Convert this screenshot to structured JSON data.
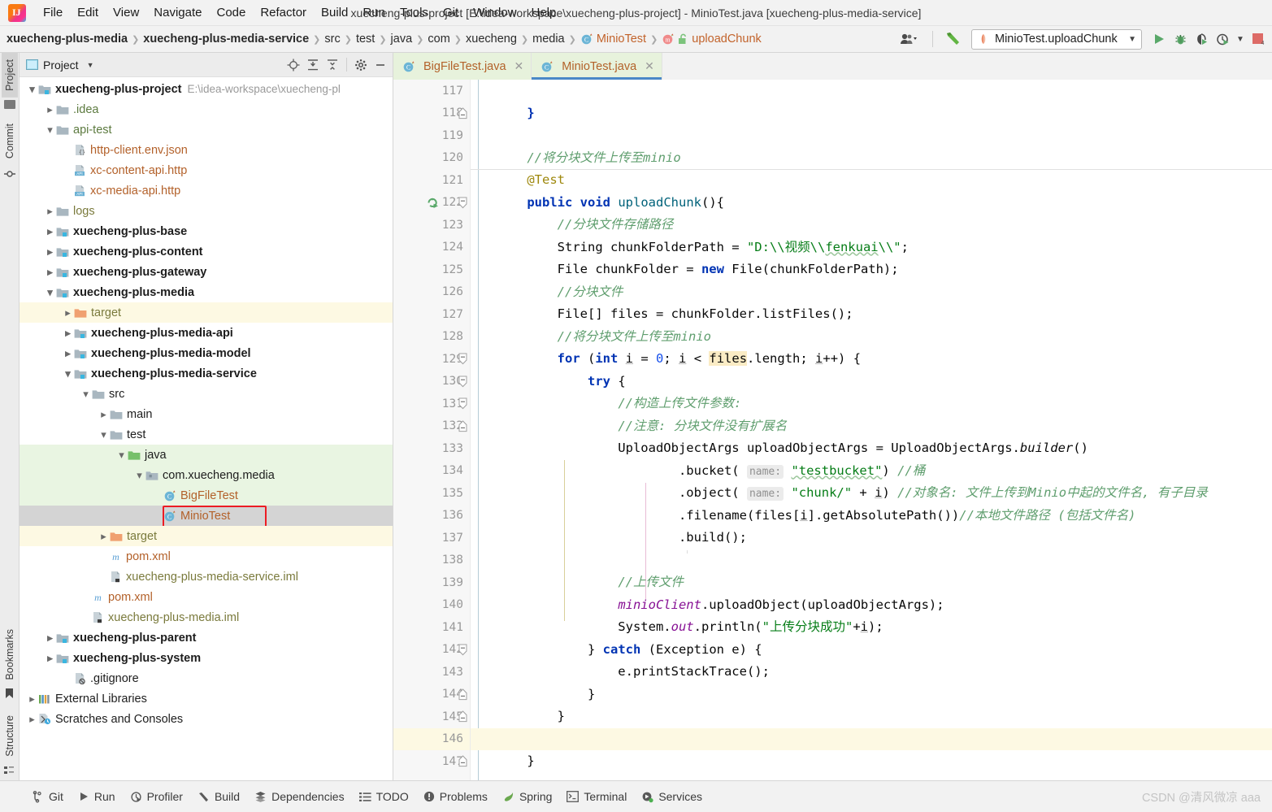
{
  "window": {
    "title": "xuecheng-plus-project [E:\\idea-workspace\\xuecheng-plus-project] - MinioTest.java [xuecheng-plus-media-service]"
  },
  "menubar": {
    "items": [
      {
        "label": "File"
      },
      {
        "label": "Edit"
      },
      {
        "label": "View"
      },
      {
        "label": "Navigate"
      },
      {
        "label": "Code"
      },
      {
        "label": "Refactor"
      },
      {
        "label": "Build"
      },
      {
        "label": "Run"
      },
      {
        "label": "Tools"
      },
      {
        "label": "Git"
      },
      {
        "label": "Window"
      },
      {
        "label": "Help"
      }
    ]
  },
  "breadcrumb": {
    "items": [
      {
        "label": "xuecheng-plus-media",
        "bold": true
      },
      {
        "label": "xuecheng-plus-media-service",
        "bold": true
      },
      {
        "label": "src"
      },
      {
        "label": "test"
      },
      {
        "label": "java"
      },
      {
        "label": "com"
      },
      {
        "label": "xuecheng"
      },
      {
        "label": "media"
      },
      {
        "label": "MinioTest",
        "icon": "java-class-icon"
      },
      {
        "label": "uploadChunk",
        "icon": "method-icon"
      }
    ]
  },
  "toolbar": {
    "run_config": "MinioTest.uploadChunk",
    "run_button": "run-button",
    "debug_button": "debug-button",
    "coverage_button": "run-with-coverage-button",
    "profile_button": "profiler-button",
    "stop_button": "stop-button",
    "build_button": "build-project-button",
    "user_button": "account-button"
  },
  "tool_strip": {
    "top": [
      {
        "label": "Project",
        "active": true
      },
      {
        "label": "Commit",
        "active": false
      }
    ],
    "bottom": [
      {
        "label": "Bookmarks"
      },
      {
        "label": "Structure"
      }
    ]
  },
  "project_panel": {
    "title": "Project",
    "actions": [
      "locate-icon",
      "expand-all-icon",
      "collapse-all-icon",
      "settings-icon",
      "hide-icon"
    ],
    "tree": [
      {
        "depth": 0,
        "label": "xuecheng-plus-project",
        "hint": "E:\\idea-workspace\\xuecheng-pl",
        "arrow": "down",
        "icon": "module-folder-icon",
        "bold": true,
        "color": "plain"
      },
      {
        "depth": 1,
        "label": ".idea",
        "arrow": "right",
        "icon": "folder-icon",
        "color": "green-dark"
      },
      {
        "depth": 1,
        "label": "api-test",
        "arrow": "down",
        "icon": "folder-icon",
        "color": "green-dark"
      },
      {
        "depth": 2,
        "label": "http-client.env.json",
        "arrow": "",
        "icon": "json-file-icon",
        "color": "orange"
      },
      {
        "depth": 2,
        "label": "xc-content-api.http",
        "arrow": "",
        "icon": "api-file-icon",
        "color": "orange"
      },
      {
        "depth": 2,
        "label": "xc-media-api.http",
        "arrow": "",
        "icon": "api-file-icon",
        "color": "orange"
      },
      {
        "depth": 1,
        "label": "logs",
        "arrow": "right",
        "icon": "folder-icon",
        "color": "olive"
      },
      {
        "depth": 1,
        "label": "xuecheng-plus-base",
        "arrow": "right",
        "icon": "module-folder-icon",
        "bold": true,
        "color": "plain"
      },
      {
        "depth": 1,
        "label": "xuecheng-plus-content",
        "arrow": "right",
        "icon": "module-folder-icon",
        "bold": true,
        "color": "plain"
      },
      {
        "depth": 1,
        "label": "xuecheng-plus-gateway",
        "arrow": "right",
        "icon": "module-folder-icon",
        "bold": true,
        "color": "plain"
      },
      {
        "depth": 1,
        "label": "xuecheng-plus-media",
        "arrow": "down",
        "icon": "module-folder-icon",
        "bold": true,
        "color": "plain"
      },
      {
        "depth": 2,
        "label": "target",
        "arrow": "right",
        "icon": "excluded-folder-icon",
        "color": "olive",
        "highlight": "yellow"
      },
      {
        "depth": 2,
        "label": "xuecheng-plus-media-api",
        "arrow": "right",
        "icon": "module-folder-icon",
        "bold": true,
        "color": "plain"
      },
      {
        "depth": 2,
        "label": "xuecheng-plus-media-model",
        "arrow": "right",
        "icon": "module-folder-icon",
        "bold": true,
        "color": "plain"
      },
      {
        "depth": 2,
        "label": "xuecheng-plus-media-service",
        "arrow": "down",
        "icon": "module-folder-icon",
        "bold": true,
        "color": "plain"
      },
      {
        "depth": 3,
        "label": "src",
        "arrow": "down",
        "icon": "folder-icon",
        "color": "plain"
      },
      {
        "depth": 4,
        "label": "main",
        "arrow": "right",
        "icon": "folder-icon",
        "color": "plain"
      },
      {
        "depth": 4,
        "label": "test",
        "arrow": "down",
        "icon": "folder-icon",
        "color": "plain"
      },
      {
        "depth": 5,
        "label": "java",
        "arrow": "down",
        "icon": "source-folder-icon",
        "color": "plain",
        "highlight": "green"
      },
      {
        "depth": 6,
        "label": "com.xuecheng.media",
        "arrow": "down",
        "icon": "package-icon",
        "color": "plain",
        "highlight": "green"
      },
      {
        "depth": 7,
        "label": "BigFileTest",
        "arrow": "",
        "icon": "java-class-icon",
        "color": "orange",
        "highlight": "green"
      },
      {
        "depth": 7,
        "label": "MinioTest",
        "arrow": "",
        "icon": "java-class-icon",
        "color": "orange",
        "highlight": "grey",
        "boxed": true
      },
      {
        "depth": 4,
        "label": "target",
        "arrow": "right",
        "icon": "excluded-folder-icon",
        "color": "olive",
        "highlight": "yellow"
      },
      {
        "depth": 4,
        "label": "pom.xml",
        "arrow": "",
        "icon": "maven-icon",
        "color": "orange"
      },
      {
        "depth": 4,
        "label": "xuecheng-plus-media-service.iml",
        "arrow": "",
        "icon": "iml-file-icon",
        "color": "olive"
      },
      {
        "depth": 3,
        "label": "pom.xml",
        "arrow": "",
        "icon": "maven-icon",
        "color": "orange"
      },
      {
        "depth": 3,
        "label": "xuecheng-plus-media.iml",
        "arrow": "",
        "icon": "iml-file-icon",
        "color": "olive"
      },
      {
        "depth": 1,
        "label": "xuecheng-plus-parent",
        "arrow": "right",
        "icon": "module-folder-icon",
        "bold": true,
        "color": "plain"
      },
      {
        "depth": 1,
        "label": "xuecheng-plus-system",
        "arrow": "right",
        "icon": "module-folder-icon",
        "bold": true,
        "color": "plain"
      },
      {
        "depth": 2,
        "label": ".gitignore",
        "arrow": "",
        "icon": "gitignore-file-icon",
        "color": "plain"
      },
      {
        "depth": 0,
        "label": "External Libraries",
        "arrow": "right",
        "icon": "libraries-icon",
        "color": "plain"
      },
      {
        "depth": 0,
        "label": "Scratches and Consoles",
        "arrow": "right",
        "icon": "scratches-icon",
        "color": "plain"
      }
    ]
  },
  "editor": {
    "tabs": [
      {
        "label": "BigFileTest.java",
        "active": false,
        "icon": "java-class-icon"
      },
      {
        "label": "MinioTest.java",
        "active": true,
        "icon": "java-class-icon"
      }
    ],
    "first_line": 117,
    "lines": [
      {
        "n": 117,
        "fold": "",
        "marker": ""
      },
      {
        "n": 118,
        "fold": "end",
        "marker": ""
      },
      {
        "n": 119,
        "fold": "",
        "marker": ""
      },
      {
        "n": 120,
        "fold": "",
        "marker": ""
      },
      {
        "n": 121,
        "fold": "",
        "marker": ""
      },
      {
        "n": 122,
        "fold": "start",
        "marker": "run-test-gutter-icon"
      },
      {
        "n": 123,
        "fold": "",
        "marker": ""
      },
      {
        "n": 124,
        "fold": "",
        "marker": ""
      },
      {
        "n": 125,
        "fold": "",
        "marker": ""
      },
      {
        "n": 126,
        "fold": "",
        "marker": ""
      },
      {
        "n": 127,
        "fold": "",
        "marker": ""
      },
      {
        "n": 128,
        "fold": "",
        "marker": ""
      },
      {
        "n": 129,
        "fold": "start",
        "marker": ""
      },
      {
        "n": 130,
        "fold": "start",
        "marker": ""
      },
      {
        "n": 131,
        "fold": "start",
        "marker": ""
      },
      {
        "n": 132,
        "fold": "end",
        "marker": ""
      },
      {
        "n": 133,
        "fold": "",
        "marker": ""
      },
      {
        "n": 134,
        "fold": "",
        "marker": ""
      },
      {
        "n": 135,
        "fold": "",
        "marker": ""
      },
      {
        "n": 136,
        "fold": "",
        "marker": ""
      },
      {
        "n": 137,
        "fold": "",
        "marker": ""
      },
      {
        "n": 138,
        "fold": "",
        "marker": ""
      },
      {
        "n": 139,
        "fold": "",
        "marker": ""
      },
      {
        "n": 140,
        "fold": "",
        "marker": ""
      },
      {
        "n": 141,
        "fold": "",
        "marker": ""
      },
      {
        "n": 142,
        "fold": "start",
        "marker": ""
      },
      {
        "n": 143,
        "fold": "",
        "marker": ""
      },
      {
        "n": 144,
        "fold": "end",
        "marker": ""
      },
      {
        "n": 145,
        "fold": "end",
        "marker": ""
      },
      {
        "n": 146,
        "fold": "",
        "marker": "",
        "current": true
      },
      {
        "n": 147,
        "fold": "end",
        "marker": ""
      }
    ],
    "code_plain": [
      "",
      "    }",
      "",
      "    //将分块文件上传至minio",
      "    @Test",
      "    public void uploadChunk(){",
      "        //分块文件存储路径",
      "        String chunkFolderPath = \"D:\\\\视频\\\\fenkuai\\\\\";",
      "        File chunkFolder = new File(chunkFolderPath);",
      "        //分块文件",
      "        File[] files = chunkFolder.listFiles();",
      "        //将分块文件上传至minio",
      "        for (int i = 0; i < files.length; i++) {",
      "            try {",
      "                //构造上传文件参数:",
      "                //注意: 分块文件没有扩展名",
      "                UploadObjectArgs uploadObjectArgs = UploadObjectArgs.builder()",
      "                        .bucket( name: \"testbucket\") //桶",
      "                        .object( name: \"chunk/\" + i) //对象名: 文件上传到Minio中起的文件名, 有子目录",
      "                        .filename(files[i].getAbsolutePath())//本地文件路径 (包括文件名)",
      "                        .build();",
      "",
      "                //上传文件",
      "                minioClient.uploadObject(uploadObjectArgs);",
      "                System.out.println(\"上传分块成功\"+i);",
      "            } catch (Exception e) {",
      "                e.printStackTrace();",
      "            }",
      "        }",
      "",
      "    }"
    ]
  },
  "statusbar": {
    "items": [
      {
        "label": "Git",
        "icon": "git-icon"
      },
      {
        "label": "Run",
        "icon": "run-icon"
      },
      {
        "label": "Profiler",
        "icon": "profiler-icon"
      },
      {
        "label": "Build",
        "icon": "build-icon"
      },
      {
        "label": "Dependencies",
        "icon": "dependencies-icon"
      },
      {
        "label": "TODO",
        "icon": "todo-icon"
      },
      {
        "label": "Problems",
        "icon": "problems-icon"
      },
      {
        "label": "Spring",
        "icon": "spring-icon"
      },
      {
        "label": "Terminal",
        "icon": "terminal-icon"
      },
      {
        "label": "Services",
        "icon": "services-icon"
      }
    ],
    "watermark": "CSDN @清风微凉 aaa"
  },
  "colors": {
    "accent_blue": "#4a88c7",
    "tab_active_bg": "#e7f2dc",
    "selection_grey": "#d4d4d4",
    "highlight_yellow": "#fdf9e3",
    "highlight_green": "#e9f5e2",
    "redbox": "#ec1c24",
    "run_green": "#59a869"
  }
}
